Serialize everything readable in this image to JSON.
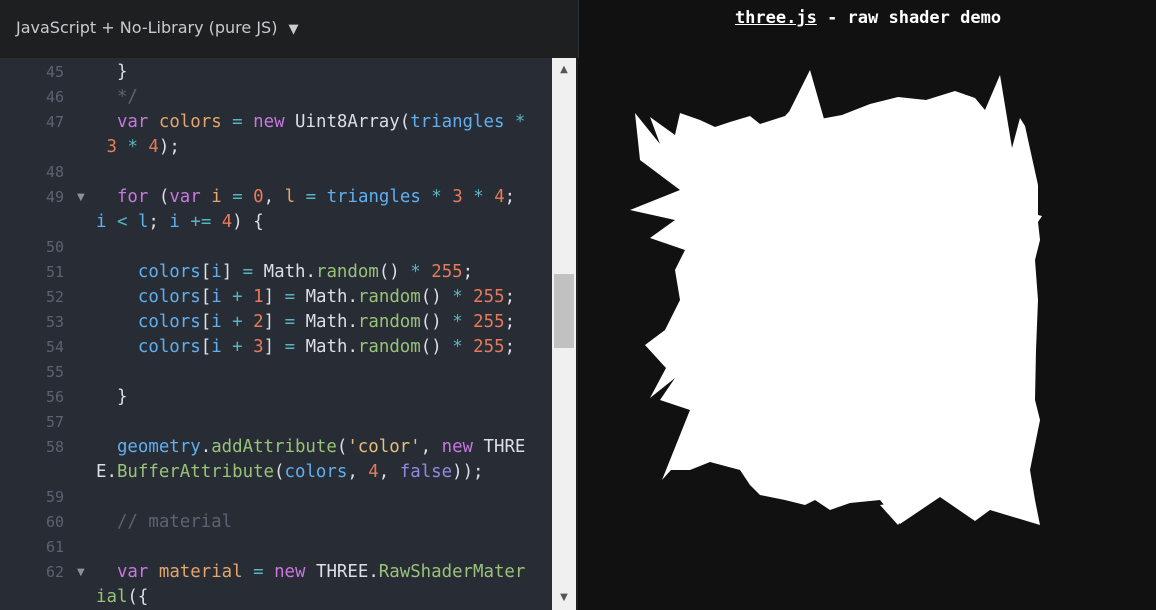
{
  "editor": {
    "language_selector": "JavaScript + No-Library (pure JS)",
    "dropdown_icon": "caret-down-icon",
    "line_numbers": [
      "45",
      "46",
      "47",
      "48",
      "49",
      "50",
      "51",
      "52",
      "53",
      "54",
      "55",
      "56",
      "57",
      "58",
      "59",
      "60",
      "61",
      "62"
    ]
  },
  "preview": {
    "link_text": "three.js",
    "title_rest": " - raw shader demo",
    "colors": {
      "background": "#111111",
      "shape": "#ffffff"
    }
  }
}
